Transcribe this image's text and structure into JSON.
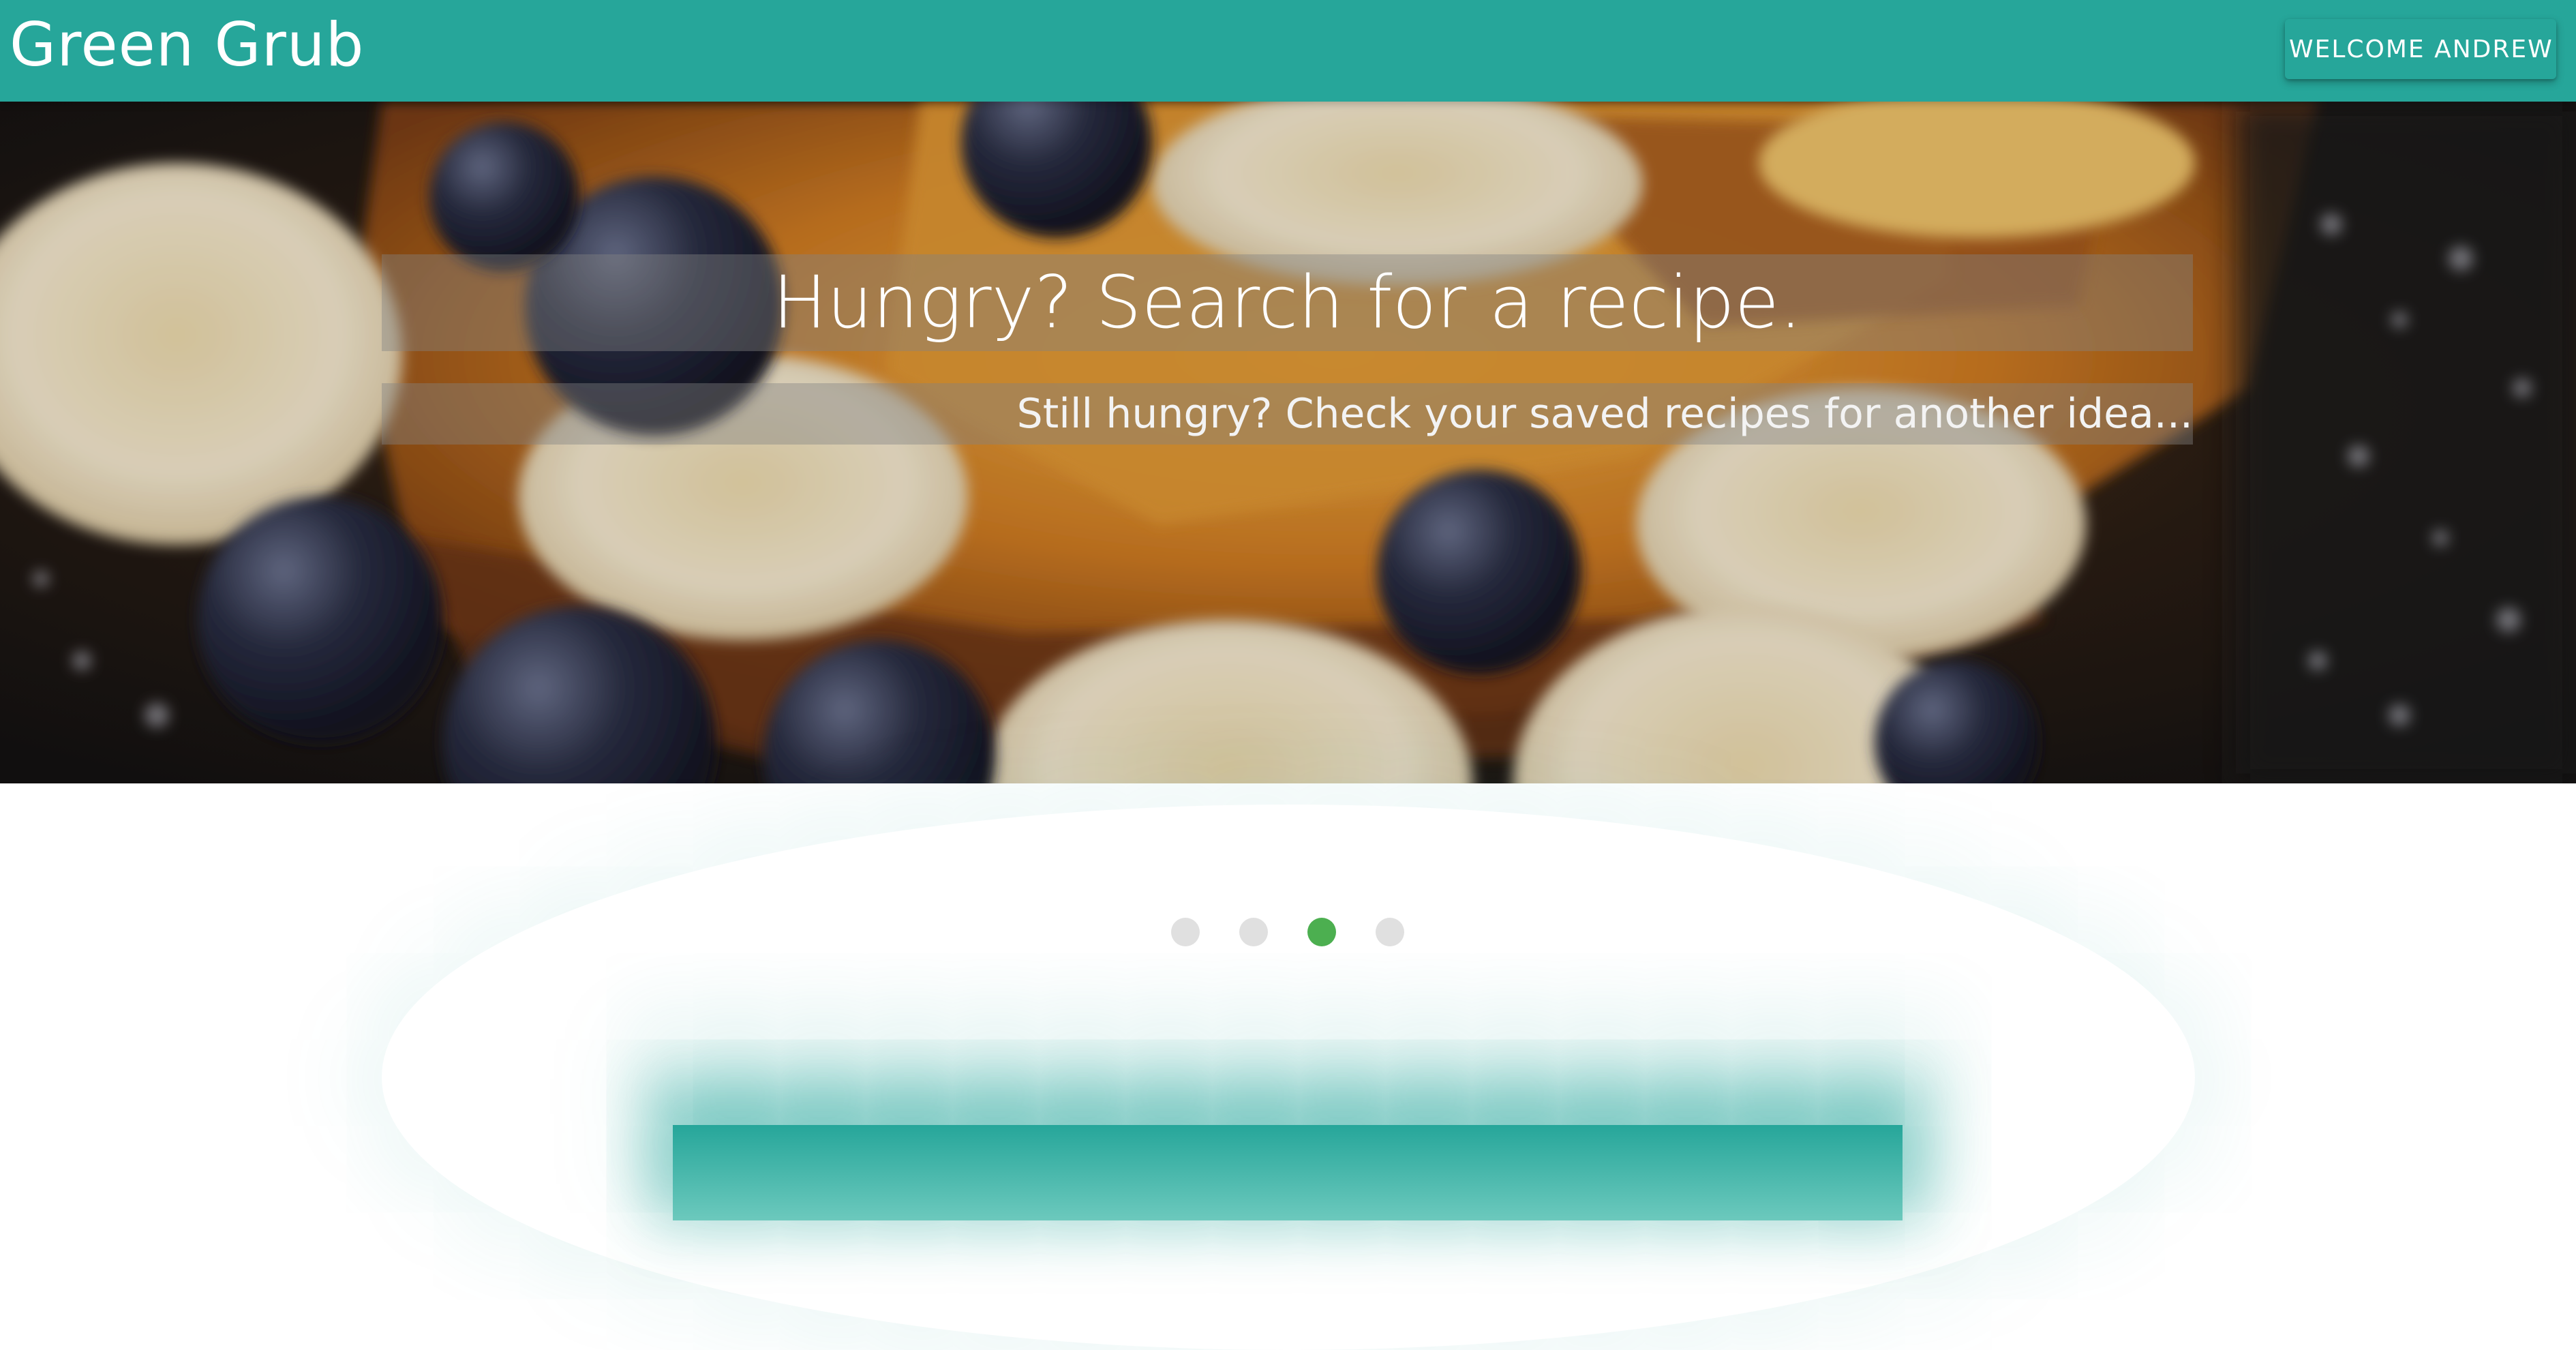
{
  "navbar": {
    "brand": "Green Grub",
    "welcome_button": "WELCOME ANDREW"
  },
  "hero": {
    "title": "Hungry? Search for a recipe.",
    "subtitle": "Still hungry? Check your saved recipes for another idea..."
  },
  "slider": {
    "slide_count": 4,
    "active_index": 2
  },
  "colors": {
    "primary": "#26a69a",
    "indicator_active": "#4caf50",
    "indicator_inactive": "#e0e0e0"
  }
}
